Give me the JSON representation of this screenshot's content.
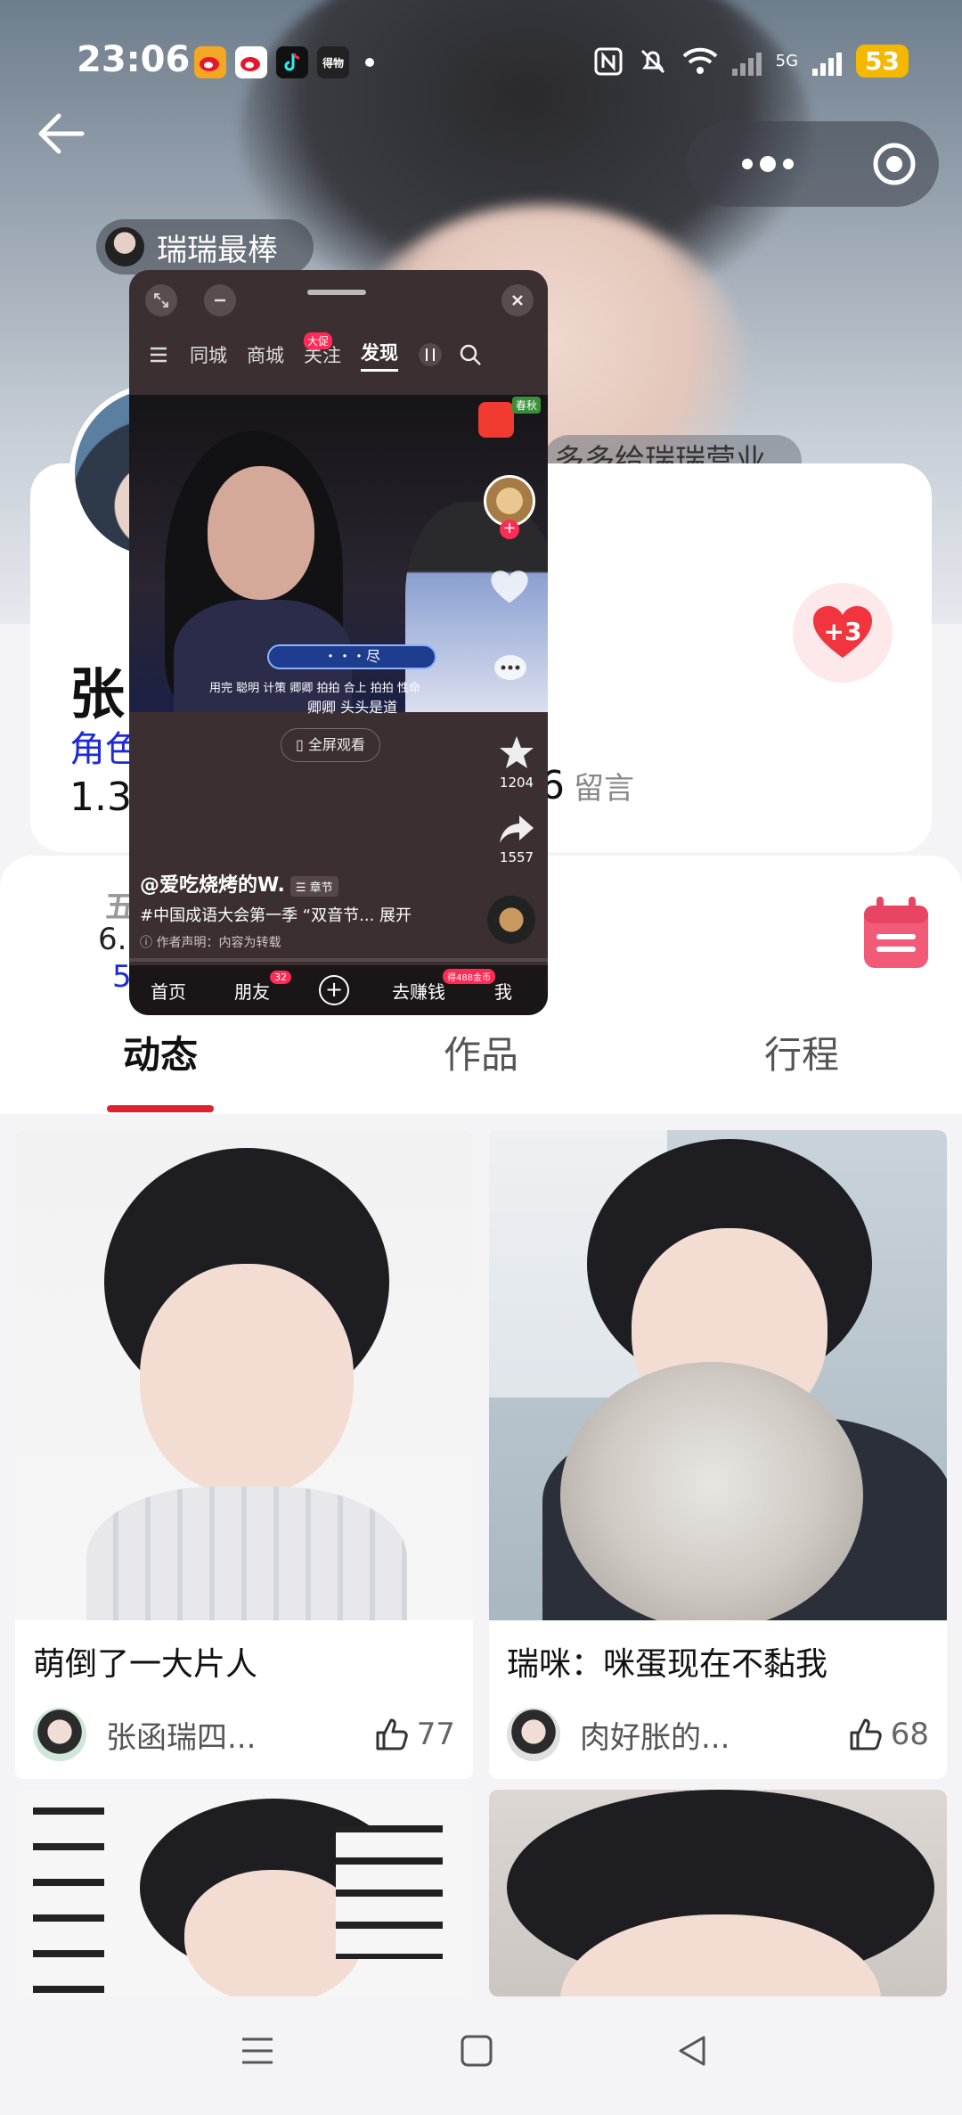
{
  "status_bar": {
    "time": "23:06",
    "battery": "53",
    "network": "5G",
    "notifications": [
      {
        "icon": "weibo-app-icon",
        "color": "#f5a623"
      },
      {
        "icon": "weibo-icon",
        "color": "#e6162d"
      },
      {
        "icon": "douyin-icon",
        "color": "#111111"
      },
      {
        "icon": "dewu-icon",
        "color": "#222222",
        "label": "得物"
      }
    ]
  },
  "header": {
    "group_name": "瑞瑞最棒",
    "behind_text": "多多给瑞瑞营业"
  },
  "profile": {
    "name": "张",
    "role": "角色",
    "stats": "1.3万",
    "messages_count": "6",
    "messages_label": "留言",
    "heart_label": "+3"
  },
  "secondary": {
    "line1": "五",
    "line2": "6.",
    "line3": "5"
  },
  "tabs": [
    {
      "label": "动态",
      "active": true
    },
    {
      "label": "作品",
      "active": false
    },
    {
      "label": "行程",
      "active": false
    }
  ],
  "feed": [
    {
      "title": "萌倒了一大片人",
      "author": "张函瑞四...",
      "likes": "77"
    },
    {
      "title": "瑞咪：咪蛋现在不黏我",
      "author": "肉好胀的...",
      "likes": "68"
    }
  ],
  "mini_window": {
    "nav": {
      "items": [
        "同城",
        "商城",
        "关注",
        "发现"
      ],
      "active": "发现",
      "mall_badge": "大促"
    },
    "video": {
      "banner": "・・・尽",
      "subtitle_top": "用完 聪明 计策 卿卿 拍拍 合上 拍拍 性命",
      "subtitle_bottom": "卿卿 头头是道",
      "badge": "春秋"
    },
    "star_count": "1204",
    "share_count": "1557",
    "fullscreen_label": "全屏观看",
    "author": "@爱吃烧烤的W.",
    "chapter_label": "章节",
    "description": "#中国成语大会第一季 “双音节... 展开",
    "note": "作者声明：内容为转载",
    "tabbar": {
      "home": "首页",
      "friends": "朋友",
      "friends_badge": "32",
      "earn": "去赚钱",
      "earn_badge": "得488金币",
      "me": "我"
    }
  }
}
